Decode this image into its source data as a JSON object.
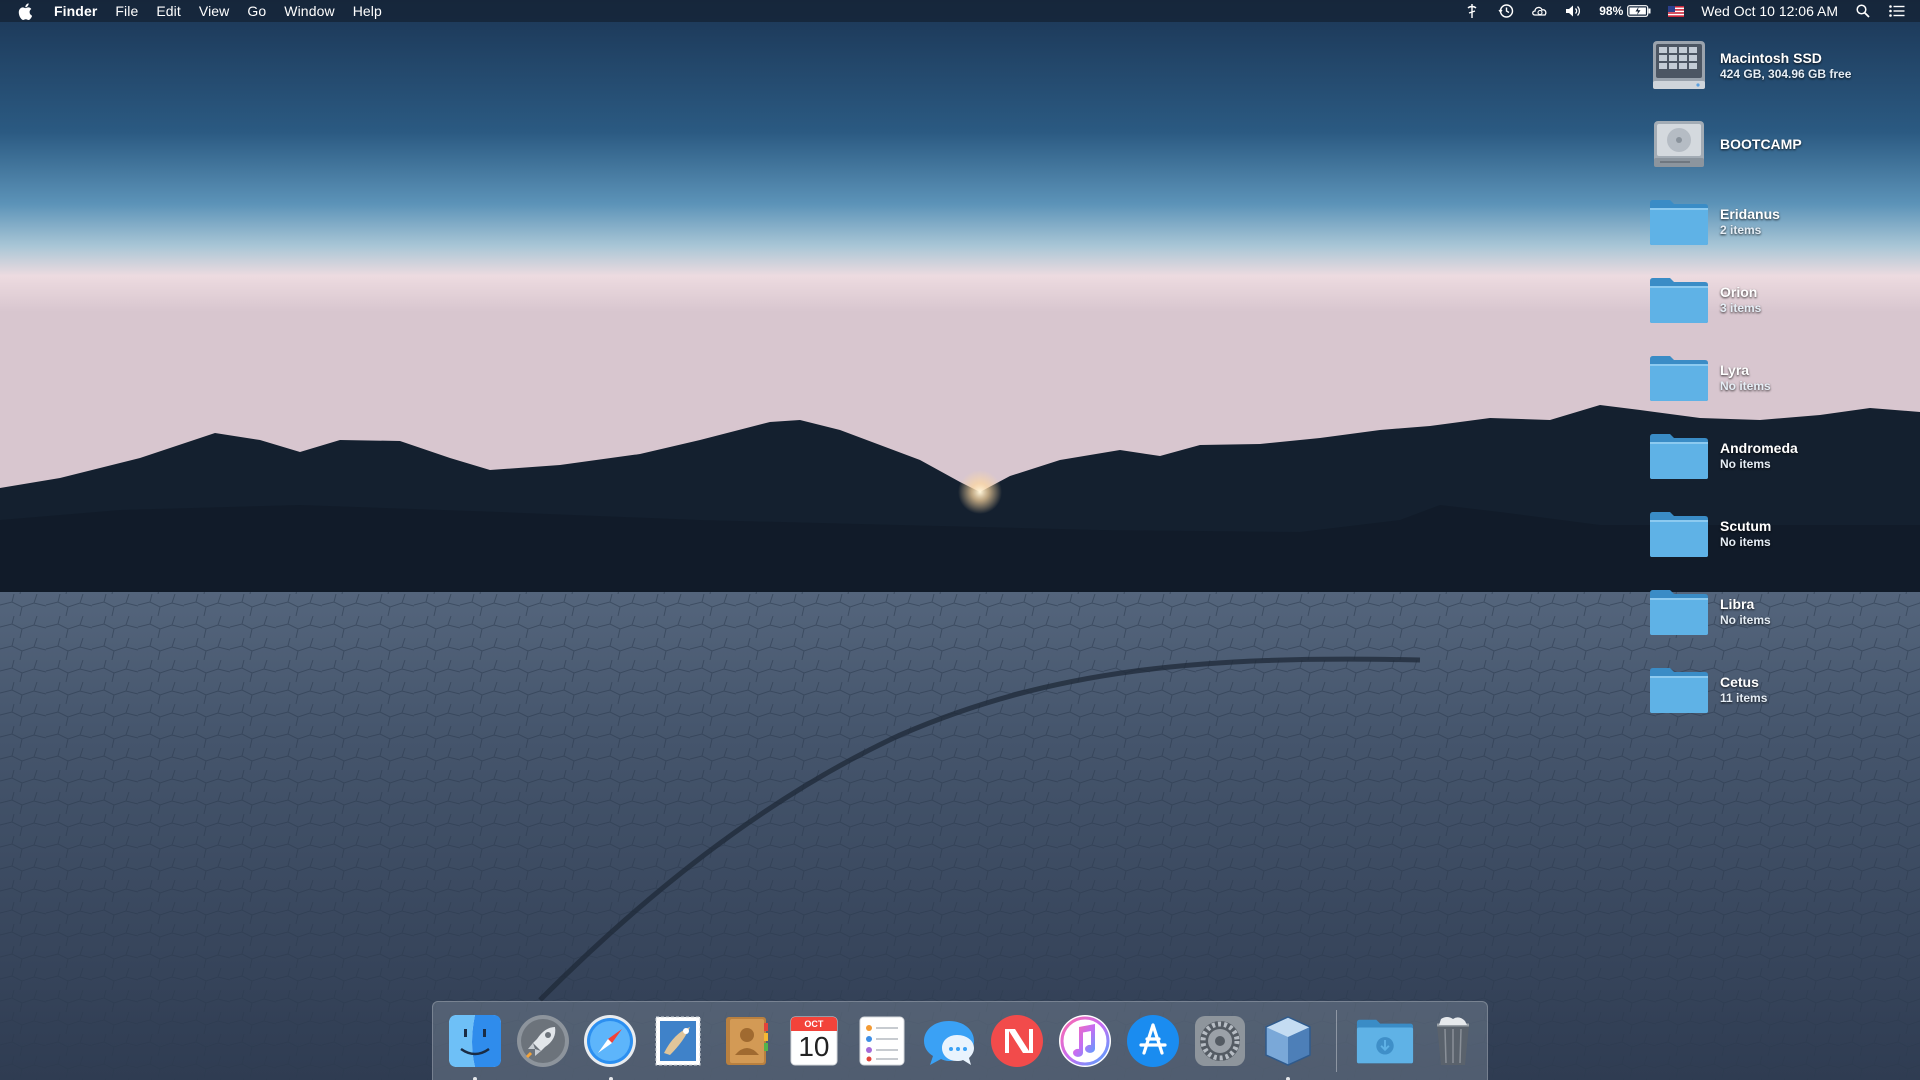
{
  "menubar": {
    "app_name": "Finder",
    "menus": [
      "File",
      "Edit",
      "View",
      "Go",
      "Window",
      "Help"
    ],
    "battery": "98%",
    "clock": "Wed Oct 10  12:06 AM"
  },
  "desktop": {
    "items": [
      {
        "name": "Macintosh SSD",
        "sub": "424 GB, 304.96 GB free",
        "kind": "ssd-icon"
      },
      {
        "name": "BOOTCAMP",
        "sub": "",
        "kind": "hard-drive-icon"
      },
      {
        "name": "Eridanus",
        "sub": "2 items",
        "kind": "folder-icon"
      },
      {
        "name": "Orion",
        "sub": "3 items",
        "kind": "folder-icon"
      },
      {
        "name": "Lyra",
        "sub": "No items",
        "kind": "folder-icon"
      },
      {
        "name": "Andromeda",
        "sub": "No items",
        "kind": "folder-icon"
      },
      {
        "name": "Scutum",
        "sub": "No items",
        "kind": "folder-icon"
      },
      {
        "name": "Libra",
        "sub": "No items",
        "kind": "folder-icon"
      },
      {
        "name": "Cetus",
        "sub": "11 items",
        "kind": "folder-icon"
      }
    ]
  },
  "dock": {
    "calendar_month": "OCT",
    "calendar_day": "10"
  },
  "colors": {
    "folder": "#4fa6dc",
    "menubar": "#142234",
    "sky_top": "#1d3a5a",
    "sky_horizon": "#f1dcdf"
  }
}
